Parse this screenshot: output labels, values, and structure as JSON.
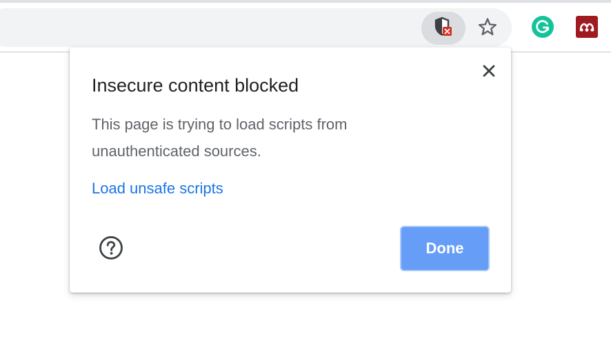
{
  "toolbar": {
    "site_security_icon": "shield-blocked-icon",
    "bookmark_icon": "star-outline-icon",
    "extensions": [
      {
        "name": "Grammarly",
        "icon": "grammarly-icon",
        "color": "#15c39a"
      },
      {
        "name": "Mendeley",
        "icon": "mendeley-icon",
        "color": "#9f1b21"
      }
    ]
  },
  "dialog": {
    "title": "Insecure content blocked",
    "message": "This page is trying to load scripts from unauthenticated sources.",
    "link_label": "Load unsafe scripts",
    "done_label": "Done",
    "close_icon": "close-icon",
    "help_icon": "help-circle-icon",
    "colors": {
      "link": "#1a73e8",
      "done_button": "#669df6",
      "title": "#202124",
      "body_text": "#5f6368"
    }
  }
}
